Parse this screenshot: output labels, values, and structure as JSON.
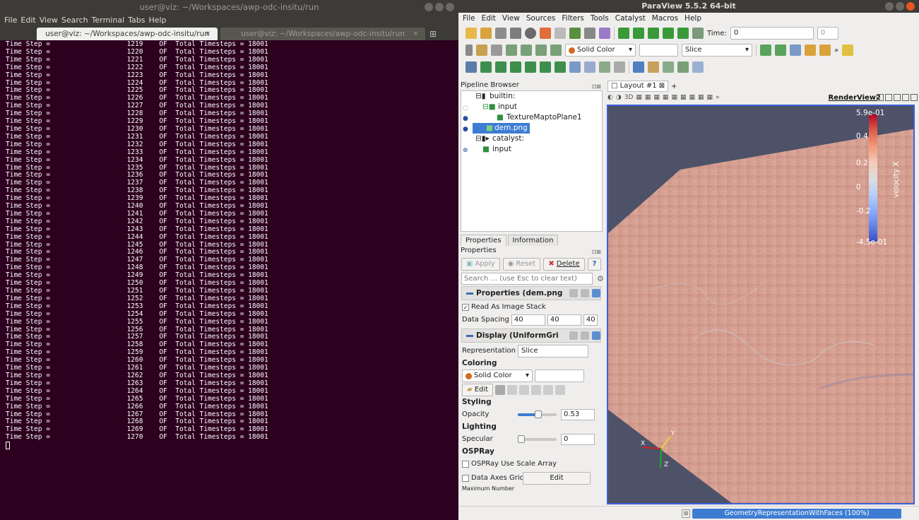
{
  "terminal": {
    "window_title": "user@viz: ~/Workspaces/awp-odc-insitu/run",
    "menu": [
      "File",
      "Edit",
      "View",
      "Search",
      "Terminal",
      "Tabs",
      "Help"
    ],
    "tabs": [
      {
        "label": "user@viz: ~/Workspaces/awp-odc-insitu/run",
        "close": "×",
        "active": true
      },
      {
        "label": "user@viz: ~/Workspaces/awp-odc-insitu/run",
        "close": "×",
        "active": false
      }
    ],
    "new_tab": "⊞",
    "lines": [
      "Time Step =                   1219    OF  Total Timesteps = 18001",
      "Time Step =                   1220    OF  Total Timesteps = 18001",
      "Time Step =                   1221    OF  Total Timesteps = 18001",
      "Time Step =                   1222    OF  Total Timesteps = 18001",
      "Time Step =                   1223    OF  Total Timesteps = 18001",
      "Time Step =                   1224    OF  Total Timesteps = 18001",
      "Time Step =                   1225    OF  Total Timesteps = 18001",
      "Time Step =                   1226    OF  Total Timesteps = 18001",
      "Time Step =                   1227    OF  Total Timesteps = 18001",
      "Time Step =                   1228    OF  Total Timesteps = 18001",
      "Time Step =                   1229    OF  Total Timesteps = 18001",
      "Time Step =                   1230    OF  Total Timesteps = 18001",
      "Time Step =                   1231    OF  Total Timesteps = 18001",
      "Time Step =                   1232    OF  Total Timesteps = 18001",
      "Time Step =                   1233    OF  Total Timesteps = 18001",
      "Time Step =                   1234    OF  Total Timesteps = 18001",
      "Time Step =                   1235    OF  Total Timesteps = 18001",
      "Time Step =                   1236    OF  Total Timesteps = 18001",
      "Time Step =                   1237    OF  Total Timesteps = 18001",
      "Time Step =                   1238    OF  Total Timesteps = 18001",
      "Time Step =                   1239    OF  Total Timesteps = 18001",
      "Time Step =                   1240    OF  Total Timesteps = 18001",
      "Time Step =                   1241    OF  Total Timesteps = 18001",
      "Time Step =                   1242    OF  Total Timesteps = 18001",
      "Time Step =                   1243    OF  Total Timesteps = 18001",
      "Time Step =                   1244    OF  Total Timesteps = 18001",
      "Time Step =                   1245    OF  Total Timesteps = 18001",
      "Time Step =                   1246    OF  Total Timesteps = 18001",
      "Time Step =                   1247    OF  Total Timesteps = 18001",
      "Time Step =                   1248    OF  Total Timesteps = 18001",
      "Time Step =                   1249    OF  Total Timesteps = 18001",
      "Time Step =                   1250    OF  Total Timesteps = 18001",
      "Time Step =                   1251    OF  Total Timesteps = 18001",
      "Time Step =                   1252    OF  Total Timesteps = 18001",
      "Time Step =                   1253    OF  Total Timesteps = 18001",
      "Time Step =                   1254    OF  Total Timesteps = 18001",
      "Time Step =                   1255    OF  Total Timesteps = 18001",
      "Time Step =                   1256    OF  Total Timesteps = 18001",
      "Time Step =                   1257    OF  Total Timesteps = 18001",
      "Time Step =                   1258    OF  Total Timesteps = 18001",
      "Time Step =                   1259    OF  Total Timesteps = 18001",
      "Time Step =                   1260    OF  Total Timesteps = 18001",
      "Time Step =                   1261    OF  Total Timesteps = 18001",
      "Time Step =                   1262    OF  Total Timesteps = 18001",
      "Time Step =                   1263    OF  Total Timesteps = 18001",
      "Time Step =                   1264    OF  Total Timesteps = 18001",
      "Time Step =                   1265    OF  Total Timesteps = 18001",
      "Time Step =                   1266    OF  Total Timesteps = 18001",
      "Time Step =                   1267    OF  Total Timesteps = 18001",
      "Time Step =                   1268    OF  Total Timesteps = 18001",
      "Time Step =                   1269    OF  Total Timesteps = 18001",
      "Time Step =                   1270    OF  Total Timesteps = 18001"
    ]
  },
  "paraview": {
    "window_title": "ParaView 5.5.2 64-bit",
    "menu": [
      "File",
      "Edit",
      "View",
      "Sources",
      "Filters",
      "Tools",
      "Catalyst",
      "Macros",
      "Help"
    ],
    "time_label": "Time:",
    "time_value": "0",
    "time_index": "0",
    "coloring_combo": "Solid Color",
    "representation_combo": "Slice",
    "pipeline": {
      "title": "Pipeline Browser",
      "items": [
        {
          "label": "builtin:"
        },
        {
          "label": "input"
        },
        {
          "label": "TextureMaptoPlane1"
        },
        {
          "label": "dem.png"
        },
        {
          "label": "catalyst:"
        },
        {
          "label": "input"
        }
      ]
    },
    "properties": {
      "tabs": [
        "Properties",
        "Information"
      ],
      "title": "Properties",
      "apply": "Apply",
      "reset": "Reset",
      "delete": "Delete",
      "help": "?",
      "search_placeholder": "Search ... (use Esc to clear text)",
      "section_properties": "Properties (dem.png",
      "read_as_image_stack": "Read As Image Stack",
      "data_spacing_label": "Data Spacing",
      "data_spacing": [
        "40",
        "40",
        "40"
      ],
      "section_display": "Display (UniformGri",
      "representation_label": "Representation",
      "representation_value": "Slice",
      "coloring_header": "Coloring",
      "coloring_value": "Solid Color",
      "edit_button": "Edit",
      "styling_header": "Styling",
      "opacity_label": "Opacity",
      "opacity_value": "0.53",
      "opacity_fraction": 0.53,
      "lighting_header": "Lighting",
      "specular_label": "Specular",
      "specular_value": "0",
      "ospray_header": "OSPRay",
      "ospray_scale": "OSPRay Use Scale Array",
      "data_axes_grid": "Data Axes Grid",
      "data_axes_edit": "Edit",
      "maximum_number": "Maximum Number"
    },
    "layout": {
      "tab_label": "Layout #1",
      "tab_close": "⊠",
      "new_tab": "+",
      "view_name": "RenderView2",
      "view_toolbar_text": "3D"
    },
    "colorbar": {
      "title": "velocity X",
      "ticks": [
        "5.9e-01",
        "0.4",
        "0.2",
        "0",
        "-0.2",
        "-4.5e-01"
      ]
    },
    "axes": {
      "x": "X",
      "y": "Y",
      "z": "Z"
    },
    "status": {
      "progress_label": "GeometryRepresentationWithFaces (100%)",
      "progress_fraction": 1.0,
      "stop_icon": "⊠"
    },
    "colors": {
      "terminal_bg": "#2c001e",
      "selection": "#3d7cd3",
      "view_border": "#3d5fd8",
      "close_button": "#e95420"
    }
  }
}
